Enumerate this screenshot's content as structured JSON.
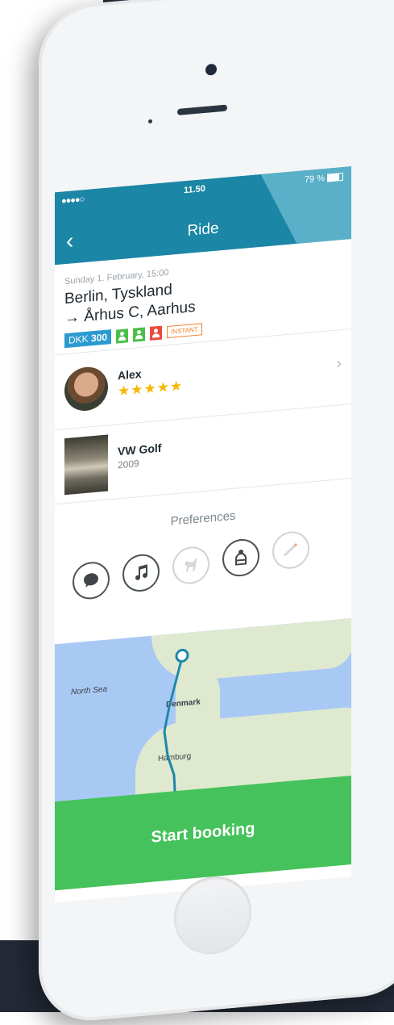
{
  "status_bar": {
    "signal": "●●●●○",
    "time": "11.50",
    "battery": "79 %"
  },
  "header": {
    "title": "Ride",
    "back_icon": "chevron-left-icon"
  },
  "trip": {
    "date": "Sunday 1. February, 15:00",
    "from": "Berlin, Tyskland",
    "to": "→ Århus C, Aarhus",
    "price_currency": "DKK",
    "price_value": "300",
    "instant_badge": "INSTANT",
    "seats": {
      "free": 2,
      "taken": 1
    }
  },
  "driver": {
    "name": "Alex",
    "rating_stars": "★★★★★",
    "rating": 5
  },
  "car": {
    "model": "VW Golf",
    "year": "2009"
  },
  "preferences": {
    "title": "Preferences",
    "icons": [
      {
        "icon": "chat-icon",
        "active": true
      },
      {
        "icon": "music-icon",
        "active": true
      },
      {
        "icon": "pet-icon",
        "active": false
      },
      {
        "icon": "seat-icon",
        "active": true
      },
      {
        "icon": "cigarette-icon",
        "active": false
      }
    ]
  },
  "map": {
    "label_sea": "North Sea",
    "label_country": "Denmark",
    "label_city": "Hamburg"
  },
  "booking": {
    "button_label": "Start booking"
  },
  "colors": {
    "header": "#1b86a5",
    "accent_green": "#45c25b",
    "price_blue": "#2b9ad0",
    "taken_red": "#e94b3c",
    "star": "#f5b800"
  }
}
